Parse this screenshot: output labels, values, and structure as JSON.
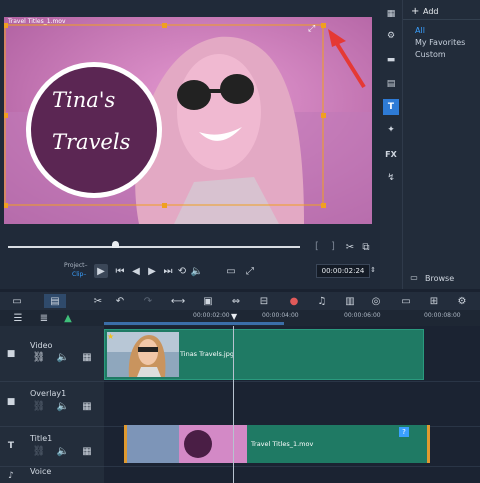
{
  "preview": {
    "clip_name": "Travel Titles_1.mov",
    "title_line1": "Tina's",
    "title_line2": "Travels",
    "project_label": "Project–",
    "clip_label": "Clip–",
    "timecode": "00:00:02:24"
  },
  "title_panel": {
    "add_label": "Add",
    "categories": [
      "All",
      "My Favorites",
      "Custom"
    ],
    "browse_label": "Browse"
  },
  "timeline": {
    "ruler_labels": [
      "00:00:02:00",
      "00:00:04:00",
      "00:00:06:00",
      "00:00:08:00"
    ],
    "tracks": [
      {
        "name": "Video"
      },
      {
        "name": "Overlay1"
      },
      {
        "name": "Title1"
      },
      {
        "name": "Voice"
      }
    ],
    "video_clip_name": "Tinas Travels.jpg",
    "title_clip_name": "Travel Titles_1.mov"
  },
  "colors": {
    "accent": "#3aa0ff",
    "video_clip": "#1f7a64",
    "title_clip": "#1f7a64",
    "arrow": "#e53935"
  }
}
